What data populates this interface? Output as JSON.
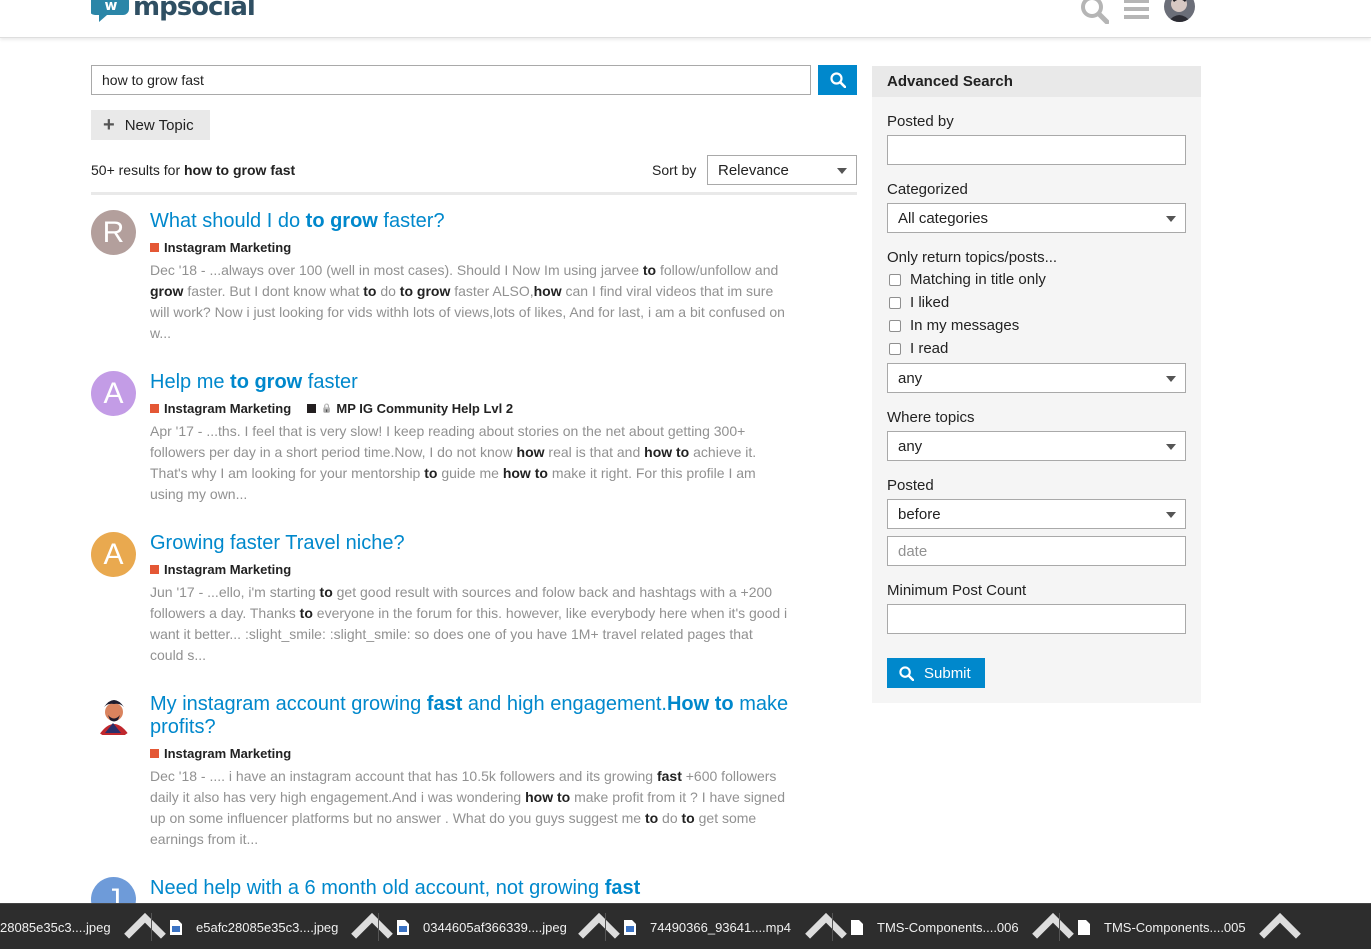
{
  "header": {
    "logo_text": "mpsocial"
  },
  "search": {
    "query": "how to grow fast",
    "placeholder": ""
  },
  "new_topic_label": "New Topic",
  "results_summary": {
    "prefix": "50+ results for",
    "term": "how to grow fast"
  },
  "sort": {
    "label": "Sort by",
    "value": "Relevance"
  },
  "results": [
    {
      "avatar_letter": "R",
      "avatar_color": "#b39f9c",
      "title": [
        [
          "What should I do ",
          false
        ],
        [
          "to grow",
          true
        ],
        [
          " faster?",
          false
        ]
      ],
      "categories": [
        {
          "name": "Instagram Marketing",
          "color": "#e45735",
          "locked": false
        }
      ],
      "blurb": [
        [
          "Dec '18 - ...always over 100 (well in most cases). Should I Now Im using jarvee ",
          false
        ],
        [
          "to",
          true
        ],
        [
          " follow/unfollow and ",
          false
        ],
        [
          "grow",
          true
        ],
        [
          " faster. But I dont know what ",
          false
        ],
        [
          "to",
          true
        ],
        [
          " do ",
          false
        ],
        [
          "to grow",
          true
        ],
        [
          " faster ALSO,",
          false
        ],
        [
          "how",
          true
        ],
        [
          " can I find viral videos that im sure will work? Now i just looking for vids withh lots of views,lots of likes, And for last, i am a bit confused on w...",
          false
        ]
      ]
    },
    {
      "avatar_letter": "A",
      "avatar_color": "#c39ce6",
      "title": [
        [
          "Help me ",
          false
        ],
        [
          "to grow",
          true
        ],
        [
          " faster",
          false
        ]
      ],
      "categories": [
        {
          "name": "Instagram Marketing",
          "color": "#e45735",
          "locked": false
        },
        {
          "name": "MP IG Community Help Lvl 2",
          "color": "#231f20",
          "locked": true
        }
      ],
      "blurb": [
        [
          "Apr '17 - ...ths. I feel that is very slow! I keep reading about stories on the net about getting 300+ followers per day in a short period time.Now, I do not know ",
          false
        ],
        [
          "how",
          true
        ],
        [
          " real is that and ",
          false
        ],
        [
          "how to",
          true
        ],
        [
          " achieve it. That's why I am looking for your mentorship ",
          false
        ],
        [
          "to",
          true
        ],
        [
          " guide me ",
          false
        ],
        [
          "how to",
          true
        ],
        [
          " make it right. For this profile I am using my own...",
          false
        ]
      ]
    },
    {
      "avatar_letter": "A",
      "avatar_color": "#e9a94f",
      "title": [
        [
          "Growing faster Travel niche?",
          false
        ]
      ],
      "categories": [
        {
          "name": "Instagram Marketing",
          "color": "#e45735",
          "locked": false
        }
      ],
      "blurb": [
        [
          "Jun '17 - ...ello, i'm starting ",
          false
        ],
        [
          "to",
          true
        ],
        [
          " get good result with sources and folow back and hashtags with a +200 followers a day. Thanks ",
          false
        ],
        [
          "to",
          true
        ],
        [
          " everyone in the forum for this. however, like everybody here when it's good i want it better... :slight_smile: :slight_smile: so does one of you have 1M+ travel related pages that could s...",
          false
        ]
      ]
    },
    {
      "avatar_letter": "",
      "avatar_color": "#ffffff",
      "title": [
        [
          "My instagram account growing ",
          false
        ],
        [
          "fast",
          true
        ],
        [
          " and high engagement.",
          false
        ],
        [
          "How to",
          true
        ],
        [
          " make profits?",
          false
        ]
      ],
      "categories": [
        {
          "name": "Instagram Marketing",
          "color": "#e45735",
          "locked": false
        }
      ],
      "blurb": [
        [
          "Dec '18 - .... i have an instagram account that has 10.5k followers and its growing ",
          false
        ],
        [
          "fast",
          true
        ],
        [
          " +600 followers daily it also has very high engagement.And i was wondering ",
          false
        ],
        [
          "how to",
          true
        ],
        [
          " make profit from it ? I have signed up on some influencer platforms but no answer . What do you guys suggest me ",
          false
        ],
        [
          "to",
          true
        ],
        [
          " do ",
          false
        ],
        [
          "to",
          true
        ],
        [
          " get some earnings from it...",
          false
        ]
      ]
    },
    {
      "avatar_letter": "J",
      "avatar_color": "#6e9bd9",
      "title": [
        [
          "Need help with a 6 month old account, not growing ",
          false
        ],
        [
          "fast",
          true
        ]
      ],
      "categories": [],
      "blurb": []
    }
  ],
  "advanced": {
    "heading": "Advanced Search",
    "posted_by_label": "Posted by",
    "posted_by_value": "",
    "categorized_label": "Categorized",
    "categorized_value": "All categories",
    "only_return_label": "Only return topics/posts...",
    "checkboxes": [
      "Matching in title only",
      "I liked",
      "In my messages",
      "I read"
    ],
    "only_return_select": "any",
    "where_topics_label": "Where topics",
    "where_topics_value": "any",
    "posted_label": "Posted",
    "posted_value": "before",
    "date_placeholder": "date",
    "min_post_label": "Minimum Post Count",
    "min_post_value": "",
    "submit_label": "Submit"
  },
  "downloads": [
    {
      "name": "28085e35c3....jpeg",
      "icon": "image-file-icon"
    },
    {
      "name": "e5afc28085e35c3....jpeg",
      "icon": "image-file-icon"
    },
    {
      "name": "0344605af366339....jpeg",
      "icon": "image-file-icon"
    },
    {
      "name": "74490366_93641....mp4",
      "icon": "video-file-icon"
    },
    {
      "name": "TMS-Components....006",
      "icon": "file-icon"
    },
    {
      "name": "TMS-Components....005",
      "icon": "file-icon"
    }
  ],
  "colors": {
    "accent": "#0088cc",
    "category_instagram": "#e45735",
    "category_help": "#231f20"
  }
}
